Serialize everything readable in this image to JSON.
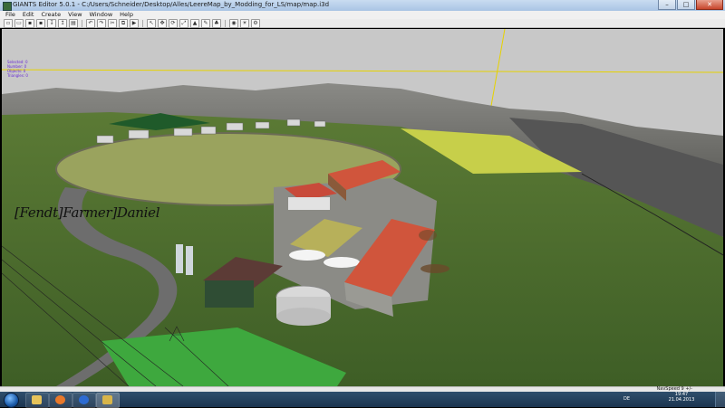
{
  "window": {
    "title": "GIANTS Editor 5.0.1 - C:/Users/Schneider/Desktop/Alles/LeereMap_by_Modding_for_LS/map/map.i3d"
  },
  "menu": [
    "File",
    "Edit",
    "Create",
    "View",
    "Window",
    "Help"
  ],
  "window_buttons": {
    "minimize": "–",
    "maximize": "□",
    "close": "✕"
  },
  "toolbar": {
    "groups": [
      [
        "new-icon",
        "open-icon",
        "save-icon",
        "save-as-icon",
        "import-icon",
        "export-icon",
        "print-icon"
      ],
      [
        "undo-icon",
        "redo-icon",
        "cut-icon",
        "copy-icon",
        "play-icon"
      ],
      [
        "select-icon",
        "move-icon",
        "rotate-icon",
        "scale-icon",
        "terrain-icon",
        "paint-icon",
        "foliage-icon"
      ],
      [
        "camera-icon",
        "light-icon",
        "settings-icon"
      ]
    ]
  },
  "viewport": {
    "overlay_lines": [
      "Selected: 0",
      "Number: 0",
      "Objects: 0",
      "Triangles: 0"
    ],
    "watermark": "[Fendt]Farmer]Daniel"
  },
  "statusbar": {
    "navspeed": "NavSpeed 9 +/-"
  },
  "taskbar": {
    "items": [
      "start-button",
      "explorer",
      "firefox",
      "media-player",
      "giants-editor"
    ],
    "language": "DE",
    "time": "19:47",
    "date": "21.04.2013"
  },
  "colors": {
    "sky": "#c8c8c8",
    "grass": "#4b6d2f",
    "roof": "#d0553c",
    "titlebar": "#bcd3ee",
    "taskbar": "#1c3550"
  }
}
